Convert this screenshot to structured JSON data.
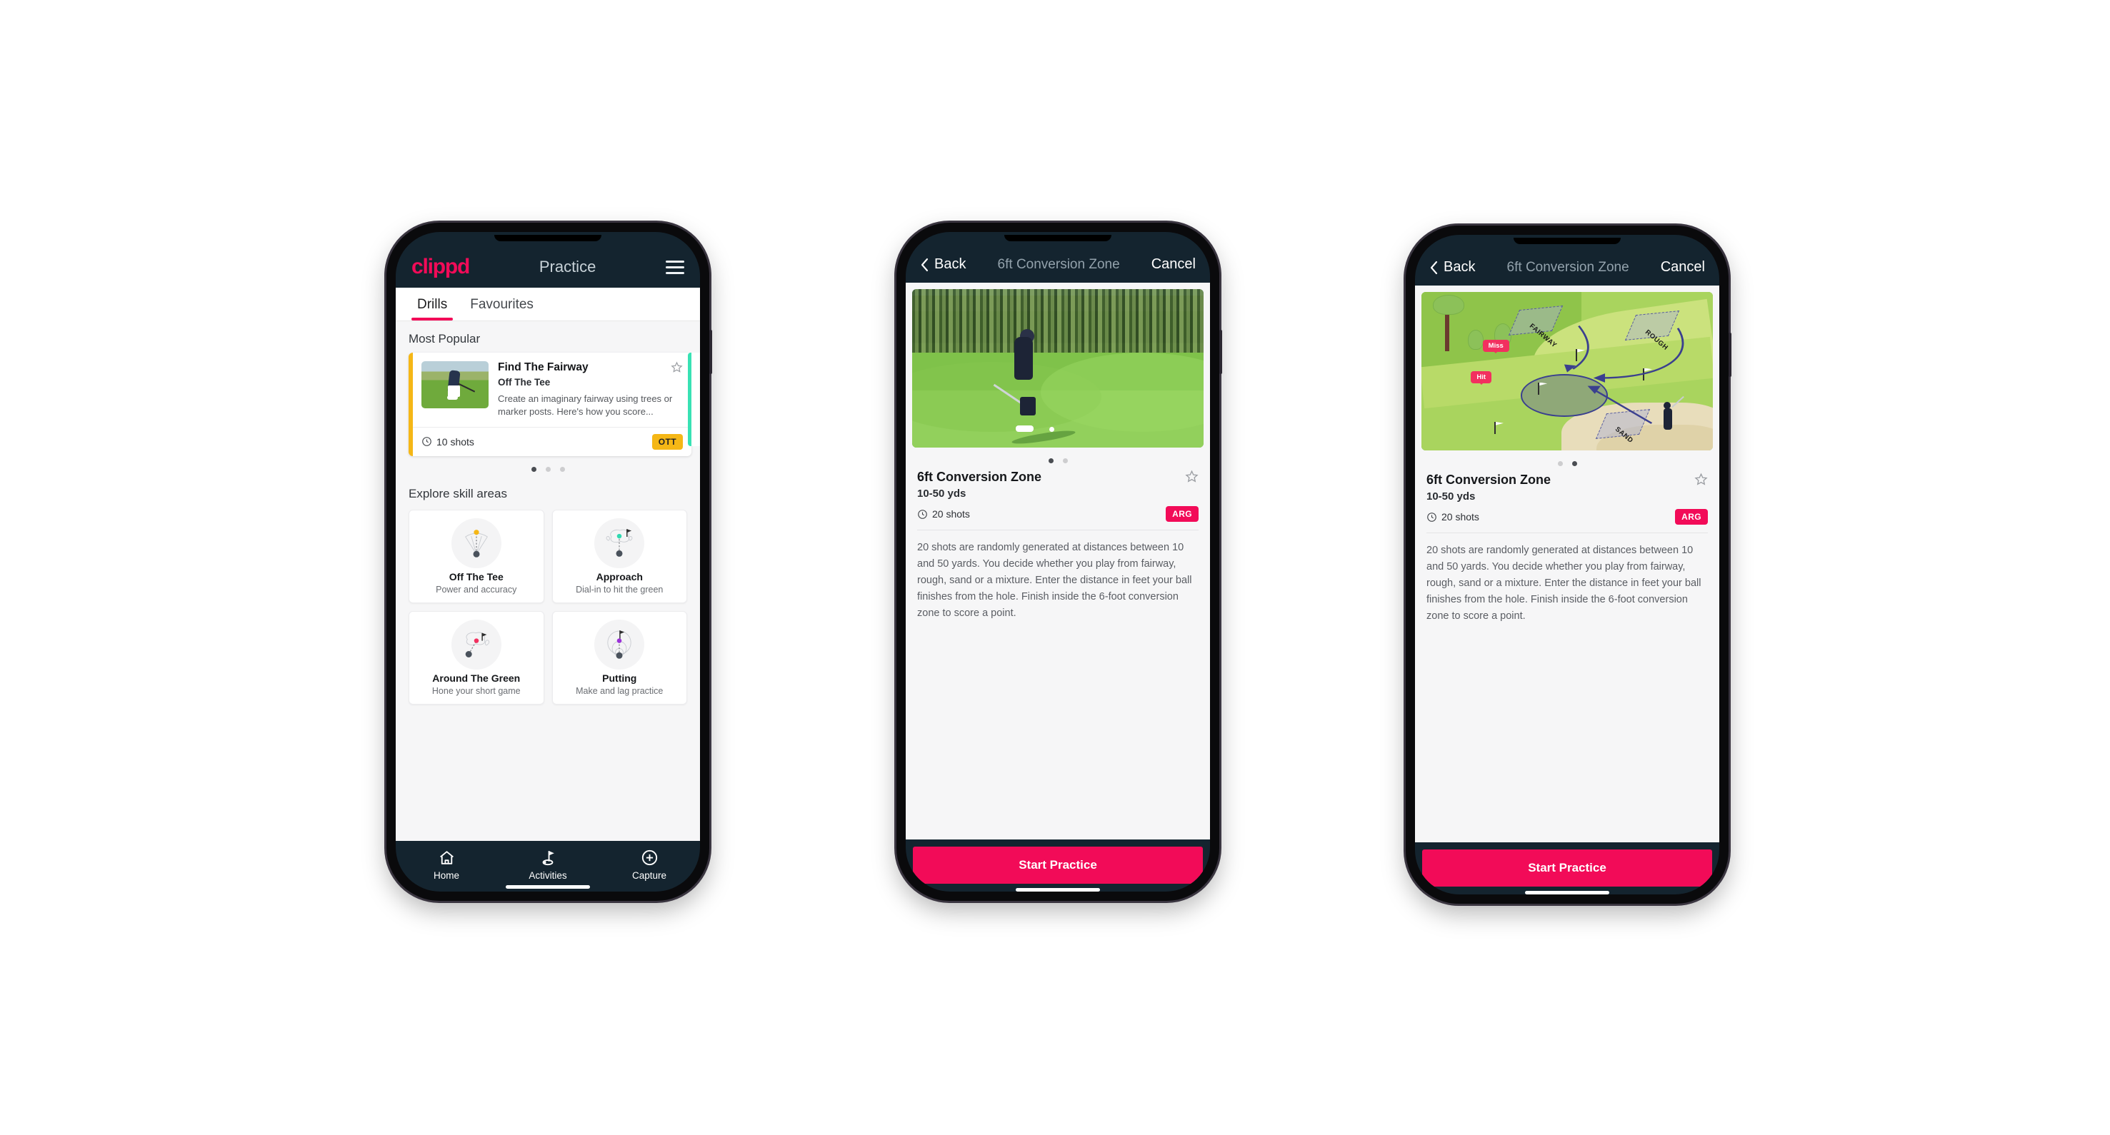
{
  "phone1": {
    "header": {
      "logo": "clippd",
      "title": "Practice",
      "menu_icon": "hamburger-icon"
    },
    "tabs": [
      {
        "label": "Drills",
        "active": true
      },
      {
        "label": "Favourites",
        "active": false
      }
    ],
    "sections": {
      "most_popular_title": "Most Popular",
      "explore_title": "Explore skill areas"
    },
    "popular_card": {
      "title": "Find The Fairway",
      "subtitle": "Off The Tee",
      "description": "Create an imaginary fairway using trees or marker posts. Here's how you score...",
      "shots": "10 shots",
      "badge": "OTT",
      "badge_color": "#f5b716",
      "accent_color": "#f5b716",
      "favourite_icon": "star-outline-icon",
      "shots_icon": "clock-icon",
      "next_card_accent": "#38e2b4"
    },
    "carousel_dots": {
      "count": 3,
      "active_index": 0
    },
    "skill_areas": [
      {
        "name": "Off The Tee",
        "desc": "Power and accuracy",
        "icon": "tee-fan-icon",
        "dot_color": "#f5b716"
      },
      {
        "name": "Approach",
        "desc": "Dial-in to hit the green",
        "icon": "green-approach-icon",
        "dot_color": "#2fd9b0"
      },
      {
        "name": "Around The Green",
        "desc": "Hone your short game",
        "icon": "chip-green-icon",
        "dot_color": "#f2305f"
      },
      {
        "name": "Putting",
        "desc": "Make and lag practice",
        "icon": "putting-rings-icon",
        "dot_color": "#9b30d9"
      }
    ],
    "tabbar": [
      {
        "label": "Home",
        "icon": "home-icon",
        "active": false
      },
      {
        "label": "Activities",
        "icon": "golf-flag-icon",
        "active": true
      },
      {
        "label": "Capture",
        "icon": "plus-circle-icon",
        "active": false
      }
    ]
  },
  "phone2": {
    "nav": {
      "back": "Back",
      "title": "6ft Conversion Zone",
      "cancel": "Cancel",
      "back_icon": "chevron-left-icon"
    },
    "media": {
      "type": "photo",
      "alt": "golfer-chipping-photo"
    },
    "dots": {
      "count": 2,
      "active_index": 0
    },
    "detail": {
      "title": "6ft Conversion Zone",
      "yards": "10-50 yds",
      "shots": "20 shots",
      "badge": "ARG",
      "badge_color": "#f20b58",
      "favourite_icon": "star-outline-icon",
      "shots_icon": "clock-icon",
      "description": "20 shots are randomly generated at distances between 10 and 50 yards. You decide whether you play from fairway, rough, sand or a mixture. Enter the distance in feet your ball finishes from the hole. Finish inside the 6-foot conversion zone to score a point."
    },
    "cta": "Start Practice"
  },
  "phone3": {
    "nav": {
      "back": "Back",
      "title": "6ft Conversion Zone",
      "cancel": "Cancel",
      "back_icon": "chevron-left-icon"
    },
    "media": {
      "type": "course-map",
      "zone_labels": [
        "FAIRWAY",
        "ROUGH",
        "SAND"
      ],
      "markers": [
        "Miss",
        "Hit"
      ],
      "marker_color": "#f2305f"
    },
    "dots": {
      "count": 2,
      "active_index": 1
    },
    "detail": {
      "title": "6ft Conversion Zone",
      "yards": "10-50 yds",
      "shots": "20 shots",
      "badge": "ARG",
      "badge_color": "#f20b58",
      "favourite_icon": "star-outline-icon",
      "shots_icon": "clock-icon",
      "description": "20 shots are randomly generated at distances between 10 and 50 yards. You decide whether you play from fairway, rough, sand or a mixture. Enter the distance in feet your ball finishes from the hole. Finish inside the 6-foot conversion zone to score a point."
    },
    "cta": "Start Practice"
  }
}
